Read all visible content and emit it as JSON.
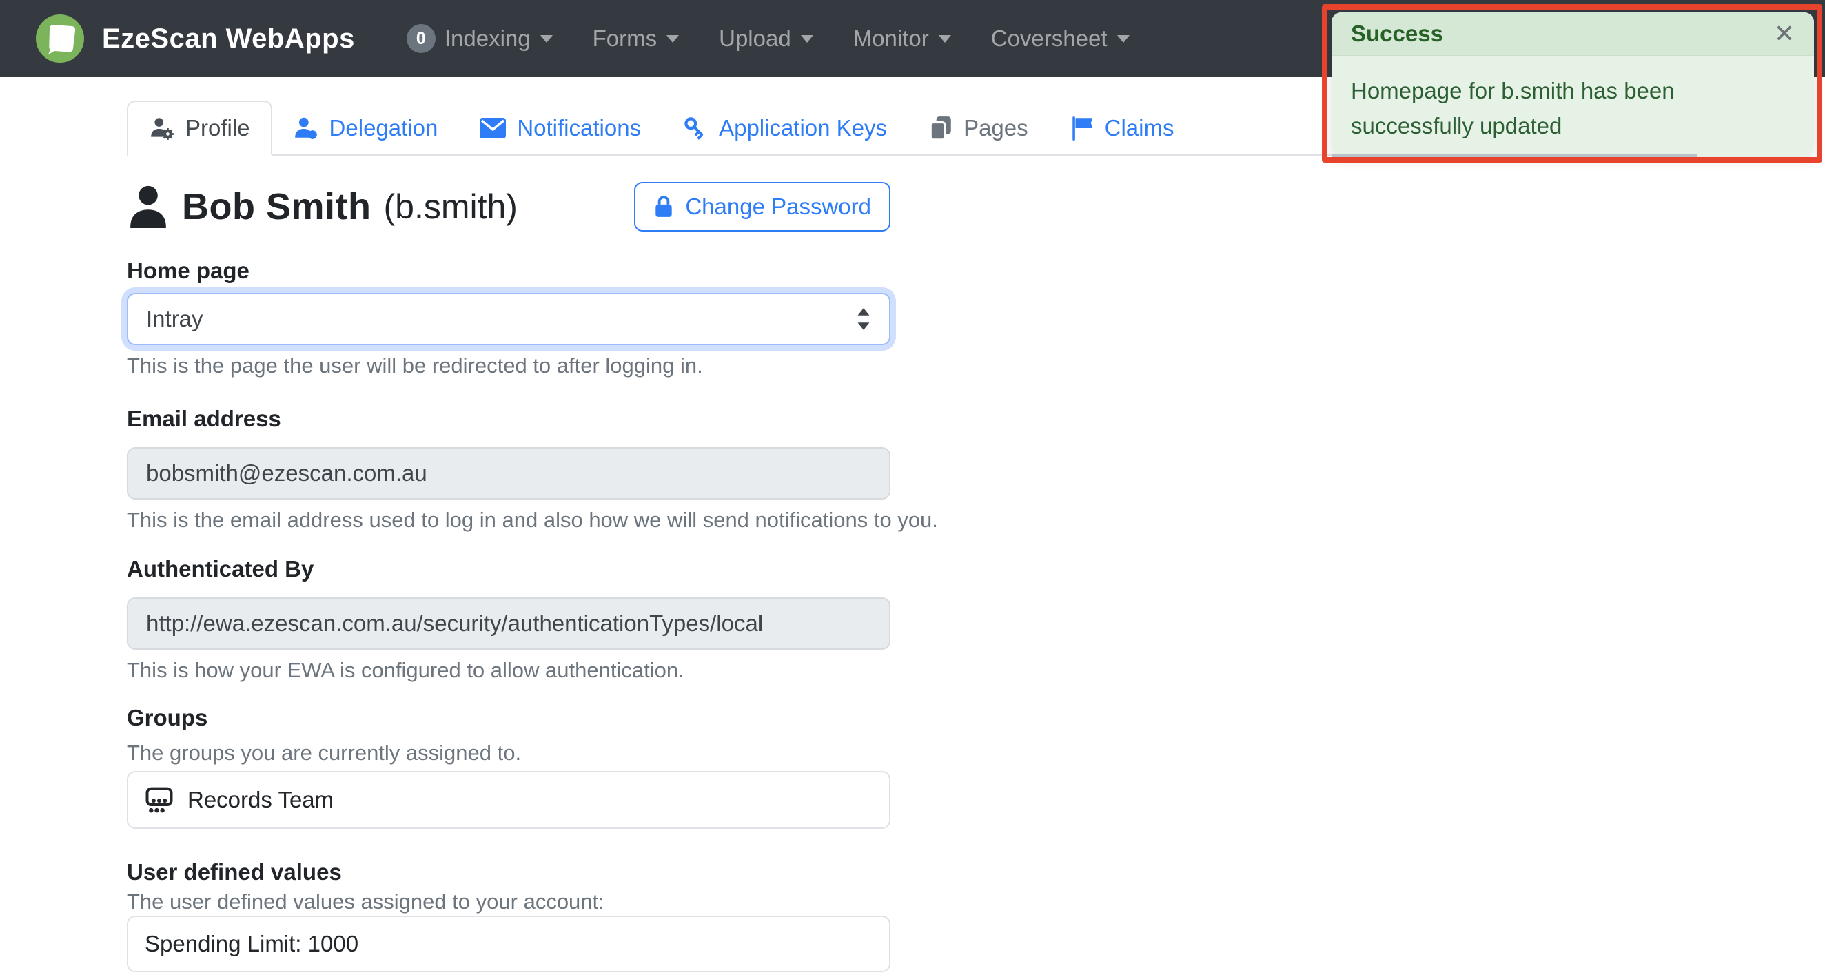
{
  "navbar": {
    "brand": "EzeScan WebApps",
    "indexing_badge": "0",
    "items": [
      {
        "label": "Indexing"
      },
      {
        "label": "Forms"
      },
      {
        "label": "Upload"
      },
      {
        "label": "Monitor"
      },
      {
        "label": "Coversheet"
      }
    ]
  },
  "tabs": {
    "items": [
      {
        "label": "Profile",
        "icon": "person-gear-icon",
        "state": "active"
      },
      {
        "label": "Delegation",
        "icon": "person-badge-icon",
        "state": "link"
      },
      {
        "label": "Notifications",
        "icon": "envelope-icon",
        "state": "link"
      },
      {
        "label": "Application Keys",
        "icon": "key-icon",
        "state": "link"
      },
      {
        "label": "Pages",
        "icon": "pages-icon",
        "state": "disabled"
      },
      {
        "label": "Claims",
        "icon": "flag-icon",
        "state": "link"
      }
    ]
  },
  "profile": {
    "display_name": "Bob Smith",
    "username_paren": "(b.smith)",
    "change_password_label": "Change Password",
    "home_page": {
      "label": "Home page",
      "value": "Intray",
      "help": "This is the page the user will be redirected to after logging in."
    },
    "email": {
      "label": "Email address",
      "value": "bobsmith@ezescan.com.au",
      "help": "This is the email address used to log in and also how we will send notifications to you."
    },
    "authenticated_by": {
      "label": "Authenticated By",
      "value": "http://ewa.ezescan.com.au/security/authenticationTypes/local",
      "help": "This is how your EWA is configured to allow authentication."
    },
    "groups": {
      "label": "Groups",
      "help": "The groups you are currently assigned to.",
      "items": [
        {
          "name": "Records Team"
        }
      ]
    },
    "user_defined_values": {
      "label": "User defined values",
      "help": "The user defined values assigned to your account:",
      "items": [
        {
          "name": "Spending Limit: 1000"
        }
      ]
    }
  },
  "toast": {
    "title": "Success",
    "message": "Homepage for b.smith has been successfully updated",
    "close_glyph": "✕"
  },
  "colors": {
    "navbar_bg": "#343a40",
    "accent_blue": "#2e7cf6",
    "disabled_gray": "#6c757d",
    "toast_header_bg": "#d5e8d5",
    "toast_body_bg": "#e7f2e7",
    "toast_text": "#2d5f34",
    "annotation_red": "#e8432c",
    "logo_green": "#7cb45c"
  }
}
